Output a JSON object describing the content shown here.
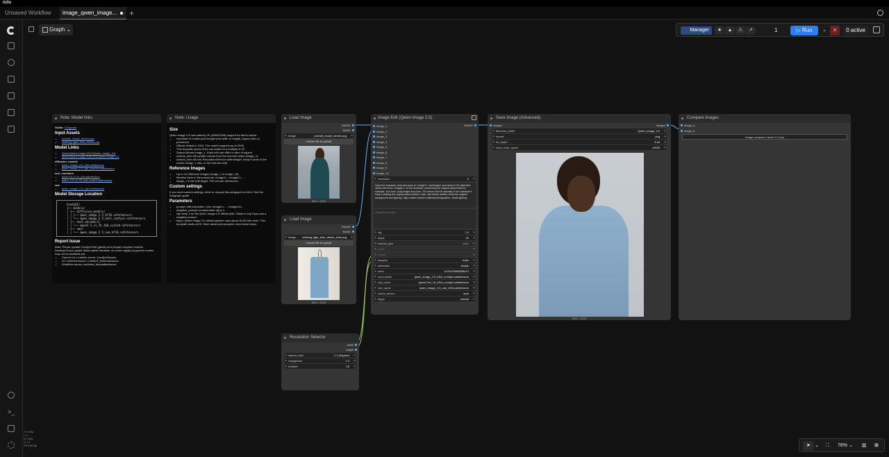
{
  "app": {
    "title": "tidle"
  },
  "tabs": [
    {
      "label": "Unsaved Workflow",
      "active": false
    },
    {
      "label": "image_qwen_image...",
      "active": true
    }
  ],
  "header": {
    "graph_label": "Graph"
  },
  "toolbar": {
    "manager_label": "Manager",
    "queue_count": "1",
    "run_label": "Run",
    "active_label": "0 active"
  },
  "notes": {
    "model_links": {
      "title": "Note: Model links",
      "guide_prefix": "Guide:",
      "guide_link": "Subgraph",
      "h_input": "Input Assets",
      "input_items": [
        "portrait_model_denim.png",
        "clothing_light_blue_denim.png"
      ],
      "h_model_links": "Model Links",
      "model_items": [
        "Qwen/Qwen-Image-2512/Qwen_Image_2.5",
        "Qwen/Qwen-Image-Edit-2511/qwen-image-2.5"
      ],
      "diffusion_label": "diffusion_models",
      "diffusion_items": [
        "qwen_image_2.5_edit.safetensors",
        "qwen_image_2.5_fp8_e4m3fn.safetensors"
      ],
      "text_label": "text_encoders",
      "text_items": [
        "qwen2.5-vl-7b_fp8.safetensors",
        "qwen_2.5_vl_7b_fp8_scaled.safetensors"
      ],
      "vae_label": "vae",
      "vae_items": [
        "qwen_image_2.5_vae.safetensors"
      ],
      "h_storage": "Model Storage Location",
      "tree": [
        "ComfyUI/",
        "├── models/",
        "│   ├── diffusion_models/",
        "│   │   ├── qwen_image_2.5_bf16.safetensors",
        "│   │   └── qwen_image_2.5_edit_comfyui.safetensors",
        "│   ├── text_encoders/",
        "│   │   └── qwen2.5_vl_7b_fp8_scaled.safetensors",
        "│   ├── vae/",
        "│   │   └── qwen_image_2.5_vae_bf16.safetensors"
      ],
      "h_report": "Report Issue",
      "report_text": "Note: Please update ComfyUI first (guide) and prepare required models. Desktop/Cloud update follow stable releases, so some nightly-supported models may not be available yet.",
      "report_items": [
        "Cannot run / runtime errors: ComfyUI/issues",
        "UI / frontend issues: ComfyUI_frontend/issues",
        "Workflow issues: workflow_templates/issues"
      ]
    },
    "usage": {
      "title": "Note: Usage",
      "h_size": "Size",
      "size_intro": "Qwen Image 2.5 now natively 2K (2048*2048) support for direct output.",
      "size_items": [
        "resolution is a total pixel budget (not width or height). Aspect ratio is preserved.",
        "Official default is 1024. The model supports up to 2048.",
        "This template works at 8x vae scales to a multiple of 32.",
        "Output follows image_1. Each edit can differ in slice of aspect.",
        "custom_size will update canvas from the encoder latent (image_1).",
        "custom_size will use ResolutionSelector width/height. Keep it close to the model; image_1 size, or the edit can shift."
      ],
      "h_ref": "Reference Images",
      "ref_items": [
        "Up to 10 reference images (image_1 to image_10).",
        "Mention them in the prompt as <image1>, <image2>, ...",
        "image_1 is the edit target. The rest are references."
      ],
      "h_custom": "Custom settings",
      "custom_text": "If you need custom settings, enter or unpack this subgraph to edit it. See the Subgraph guide.",
      "h_params": "Parameters",
      "param_items": [
        "prompt: edit instruction. Use <image1> ... <image10>.",
        "negative_prompt: unused while cfg is 1.",
        "cfg: keep 1 for the Qwen Image 2.5 official path. Raise it only if you use a negative prompt.",
        "steps: Qwen Image 2.5 official pipeline uses about 40-50 with euler. This template starts at 20. More advanced samplers need fewer steps."
      ]
    }
  },
  "load_image_1": {
    "title": "Load Image",
    "out_image": "IMAGE",
    "out_mask": "MASK",
    "image_label": "image",
    "image_value": "portrait_model_denim.png",
    "upload_label": "choose file to upload",
    "dims": "896 × 1152"
  },
  "load_image_2": {
    "title": "Load Image",
    "out_image": "IMAGE",
    "out_mask": "MASK",
    "image_label": "image",
    "image_value": "clothing_light_blue_denim_shirt.png",
    "upload_label": "choose file to upload",
    "dims": "896 × 1152"
  },
  "resolution": {
    "title": "Resolution Selector",
    "out_width": "width",
    "out_height": "height",
    "widgets": [
      {
        "label": "aspect_ratio",
        "value": "1:1 (Square)"
      },
      {
        "label": "megapixels",
        "value": "1.0"
      },
      {
        "label": "multiple",
        "value": "32"
      }
    ]
  },
  "edit": {
    "title": "Image Edit (Qwen Image 2.5)",
    "out_image": "IMAGE",
    "inputs": [
      "image_1",
      "image_2",
      "image_3",
      "image_4",
      "image_5",
      "image_6",
      "image_7",
      "image_8",
      "image_9",
      "image_10"
    ],
    "resolution_label": "resolution",
    "resolution_value": "0",
    "prompt": "Have the character wear and pose in <image1> unchanged, and dress in the light blue denim shirt from <image2> on the character, preserving the original facial features, hairstyle, skin tone, body shape and pose. The denim shirt fit naturally to the character's body, retaining the original fabric texture, color, and button details. Keep the original background and lighting. High realism fashion editorial photographic, studio lighting.",
    "negative_placeholder": "Negative prompt",
    "widgets": [
      {
        "label": "cfg",
        "value": "1.0"
      },
      {
        "label": "steps",
        "value": "20"
      }
    ],
    "custom_size_label": "custom_size",
    "custom_size_value": "false",
    "width_label": "width",
    "height_label": "height",
    "widgets2": [
      {
        "label": "sampler",
        "value": "euler"
      },
      {
        "label": "scheduler",
        "value": "simple"
      },
      {
        "label": "seed",
        "value": "1070478480828574"
      },
      {
        "label": "unet_name",
        "value": "qwen_image_2.5_bf16_comfyui.safetensors"
      },
      {
        "label": "clip_name",
        "value": "qwen2.5vl_7b_bf16_comfyui.safetensors"
      },
      {
        "label": "vae_name",
        "value": "qwen_image_2.5_vae_bf16.safetensors"
      },
      {
        "label": "cache_device",
        "value": "auto"
      },
      {
        "label": "dtype",
        "value": "default"
      }
    ]
  },
  "save": {
    "title": "Save Image (Advanced)",
    "in_images": "images",
    "out_images": "images",
    "widgets": [
      {
        "label": "filename_prefix",
        "value": "Qwen_Image_2.5"
      },
      {
        "label": "format",
        "value": "png"
      },
      {
        "label": "bit_depth",
        "value": "8-bit"
      },
      {
        "label": "input_color_space",
        "value": "sRGB"
      }
    ],
    "dims": "896 × 1152"
  },
  "compare": {
    "title": "Compare Images",
    "in_a": "image_a",
    "in_b": "image_b",
    "placeholder": "Image comparer: Node 2.5 only"
  },
  "status": {
    "lines": [
      "T: 0.00s",
      "I: 0",
      "N: 6 [0]",
      "V: 17",
      "FPS:59.88"
    ]
  },
  "zoom": {
    "value": "76%"
  }
}
